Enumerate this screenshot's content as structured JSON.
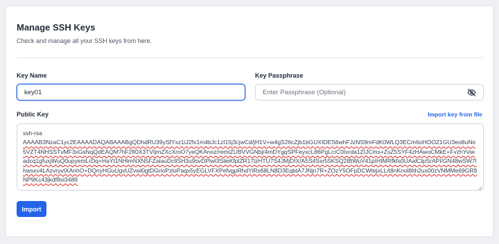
{
  "header": {
    "title": "Manage SSH Keys",
    "subtitle": "Check and manage all your SSH keys from here."
  },
  "form": {
    "key_name": {
      "label": "Key Name",
      "value": "key01"
    },
    "key_passphrase": {
      "label": "Key Passphrase",
      "placeholder": "Enter Passphrase (Optional)",
      "toggle_icon": "eye-slash-icon"
    },
    "public_key": {
      "label": "Public Key",
      "import_link": "Import key from file",
      "line1": "ssh-rsa",
      "line2": "AAAAB3NzaC1yc2EAAAADAQABAAABgQDhdRU39ySfYxz1iJ2fx1m4bJc1zI15j3cjwCd/jH1V+w4gS26cZjb1bGUXIDES6whFJzNS9mFdK0WLQ3ECm6oHOOZ1GU3eo8uNo5VZT4NHSSTvMF3xGsNqQdEAQM7hF2fI0X3TVIjmZXcXrnO7yeQKAnoz/remlZUBVVGNbj/4mDYgqSPFeyxcL86PgLcrC0Ixrda1ZIJCms+ZsZ5SYF4zHAwoCMkE+FvzhYviwadcq1gfuxjWuQ0upyemLrDq+HaYt1NHlmNXN5FZaiauDctlSH3u9svDPlwl3SlieKfplZR17lzHTU7S4JMjDIX/A5S4Ssr55KSQ2IBWuV41pIHIMRfkfs0UAalCtpSrAPI/GN48wSW7lhwsxv4LAzvryvIXAnhO+DQnyHGuUgvUZvwl0gtDGrioPzloPaqx5yEGLVFXPefvgpRhdYiRs68LN8D3EqbtA7JNjn7R+ZOzY5OFpDCWtejxLL/t8nKnol8lth2ux00zVNMMe69GR9NP9Kc43jkdf8sl3489"
    },
    "submit_label": "Import"
  },
  "colors": {
    "accent": "#2563eb",
    "spellcheck": "#dc2626"
  }
}
